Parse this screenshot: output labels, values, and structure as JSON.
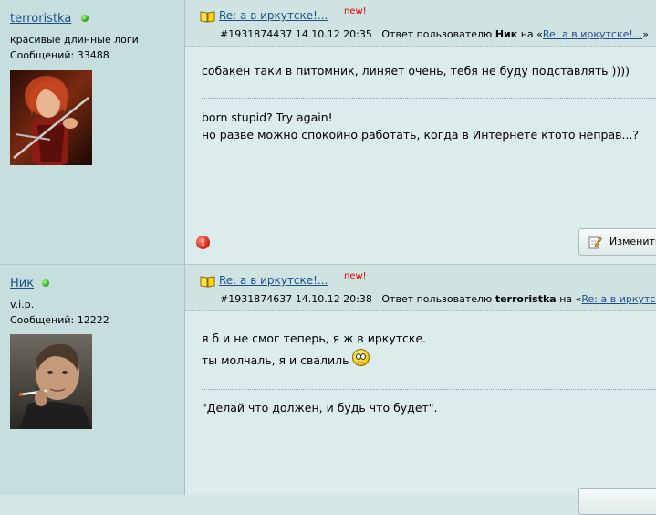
{
  "posts": [
    {
      "author": {
        "name": "terroristka",
        "title": "красивые длинные логи",
        "count": "Сообщений: 33488",
        "avatar_icon": "avatar-female-warrior"
      },
      "title": "Re: а в иркутске!...",
      "new_label": "new!",
      "number": "#1931874437",
      "datetime": "14.10.12 20:35",
      "reply_prefix": "Ответ пользователю",
      "reply_user": "Ник",
      "reply_on": "на «",
      "reply_link": "Re: а в иркутске!...",
      "reply_close": "»",
      "body": [
        "собакен таки в питомник, линяет очень, тебя не буду подставлять ))))"
      ],
      "signature": [
        "born stupid? Try again!",
        "но разве можно спокойно работать, когда в Интернете ктото неправ...?"
      ],
      "edit_label": "Изменить"
    },
    {
      "author": {
        "name": "Ник",
        "title": "v.i.p.",
        "count": "Сообщений: 12222",
        "avatar_icon": "avatar-man-smoking"
      },
      "title": "Re: а в иркутске!...",
      "new_label": "new!",
      "number": "#1931874637",
      "datetime": "14.10.12 20:38",
      "reply_prefix": "Ответ пользователю",
      "reply_user": "terroristka",
      "reply_on": "на «",
      "reply_link": "Re: а в иркутске!...",
      "body": [
        "я б и не смог теперь, я ж в иркутске.",
        "ты молчаль, я и свалиль"
      ],
      "signature": [
        "\"Делай что должен, и будь что будет\"."
      ]
    }
  ],
  "colors": {
    "background": "#d4e6e6",
    "user_pane": "#c6dede",
    "link": "#1b4f8a",
    "new_badge": "#e00000"
  }
}
